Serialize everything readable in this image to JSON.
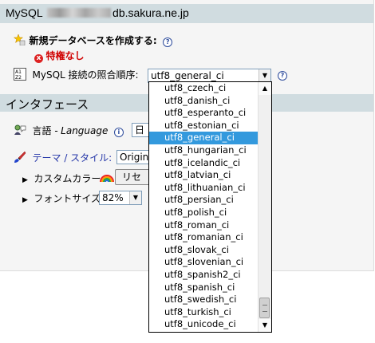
{
  "header": {
    "title_prefix": "MySQL",
    "title_suffix": "db.sakura.ne.jp"
  },
  "create_db": {
    "label": "新規データベースを作成する:",
    "help": "?",
    "status_icon": "x",
    "status_text": "特権なし"
  },
  "collation": {
    "label": "MySQL 接続の照合順序:",
    "selected_value": "utf8_general_ci",
    "help": "?"
  },
  "interface_section": {
    "title": "インタフェース"
  },
  "language": {
    "label": "言語 -",
    "label_en": "Language",
    "info": "i",
    "value_visible": "日"
  },
  "theme": {
    "label": "テーマ / スタイル:",
    "value_visible": "Origin"
  },
  "custom_color": {
    "label": "カスタムカラー:",
    "button_text": "リセッ"
  },
  "font_size": {
    "label": "フォントサイズ:",
    "value": "82%"
  },
  "dropdown": {
    "options": [
      "utf8_czech_ci",
      "utf8_danish_ci",
      "utf8_esperanto_ci",
      "utf8_estonian_ci",
      "utf8_general_ci",
      "utf8_hungarian_ci",
      "utf8_icelandic_ci",
      "utf8_latvian_ci",
      "utf8_lithuanian_ci",
      "utf8_persian_ci",
      "utf8_polish_ci",
      "utf8_roman_ci",
      "utf8_romanian_ci",
      "utf8_slovak_ci",
      "utf8_slovenian_ci",
      "utf8_spanish2_ci",
      "utf8_spanish_ci",
      "utf8_swedish_ci",
      "utf8_turkish_ci",
      "utf8_unicode_ci"
    ],
    "selected_index": 4
  },
  "colors": {
    "header_bg": "#d0dce0",
    "selected_bg": "#3399dd",
    "link": "#2335a8",
    "error": "#d00000"
  },
  "icons": {
    "create_db": "new-database-icon",
    "collation": "collation-icon",
    "language": "language-icon",
    "theme": "paintbrush-icon",
    "custom_color": "rainbow-icon"
  }
}
